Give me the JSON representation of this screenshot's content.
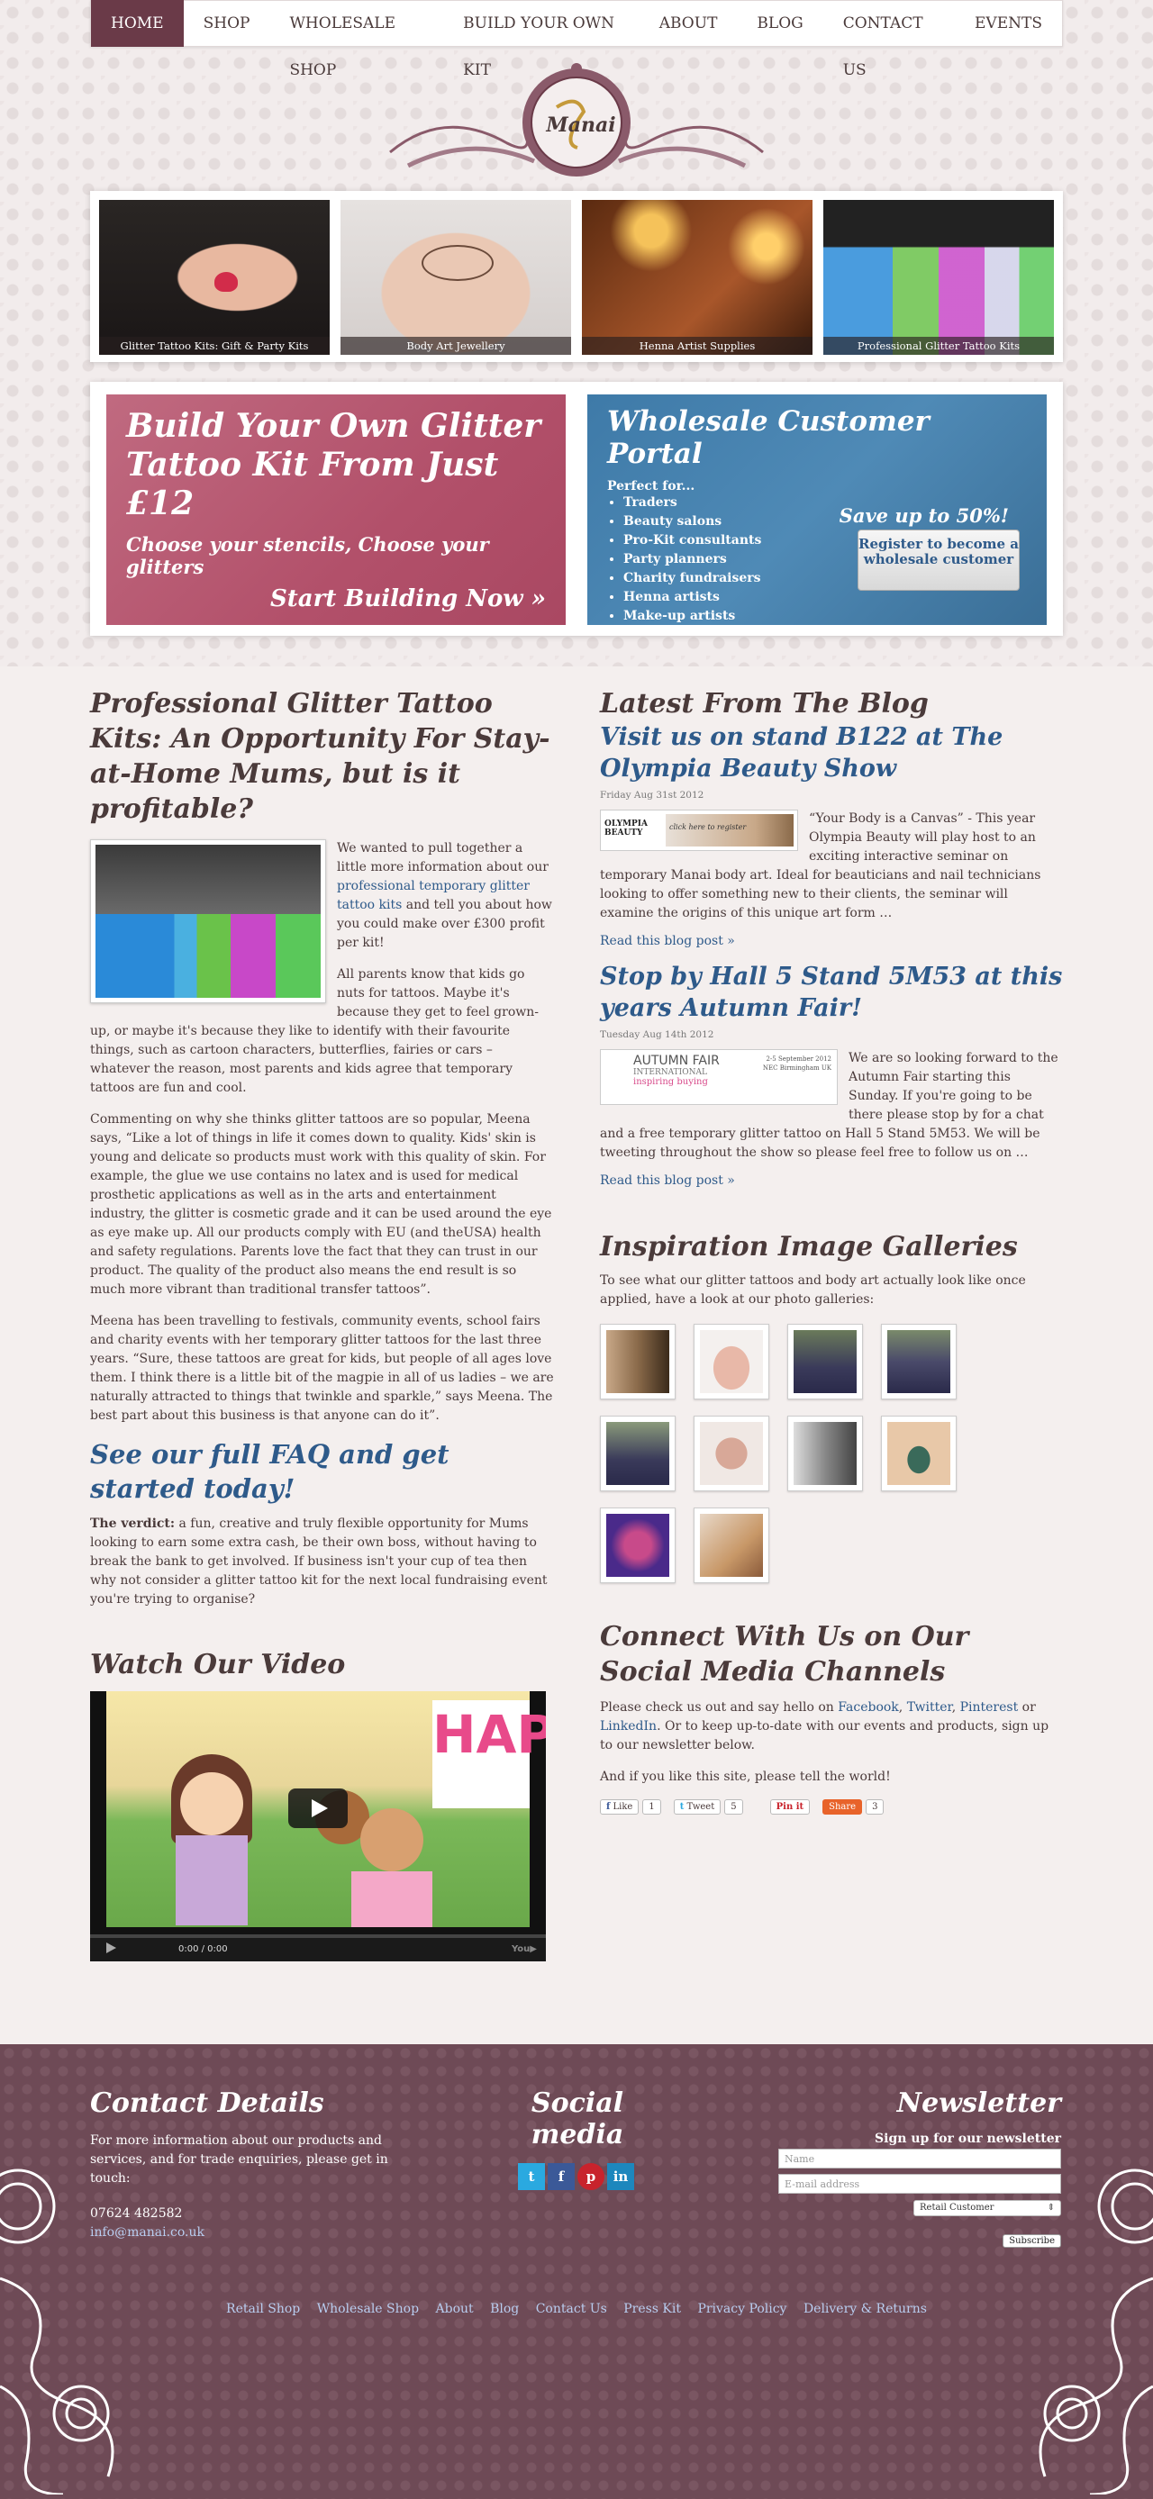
{
  "nav": {
    "items": [
      "HOME",
      "SHOP",
      "WHOLESALE SHOP",
      "BUILD YOUR OWN KIT",
      "ABOUT",
      "BLOG",
      "CONTACT US",
      "EVENTS"
    ]
  },
  "logo": {
    "text": "Manai"
  },
  "tiles": [
    {
      "caption": "Glitter Tattoo Kits: Gift & Party Kits"
    },
    {
      "caption": "Body Art Jewellery"
    },
    {
      "caption": "Henna Artist Supplies"
    },
    {
      "caption": "Professional Glitter Tattoo Kits"
    }
  ],
  "promo": {
    "kit_title": "Build Your Own Glitter Tattoo Kit From Just £12",
    "kit_sub": "Choose your stencils, Choose your glitters",
    "kit_cta": "Start Building Now »",
    "ws_title": "Wholesale Customer Portal",
    "ws_perfect": "Perfect for...",
    "ws_list": [
      "Traders",
      "Beauty salons",
      "Pro-Kit consultants",
      "Party planners",
      "Charity fundraisers",
      "Henna artists",
      "Make-up artists"
    ],
    "ws_save": "Save up to 50%!",
    "ws_button": "Register to become a wholesale customer"
  },
  "article": {
    "title": "Professional Glitter Tattoo Kits: An Opportunity For Stay-at-Home Mums, but is it profitable?",
    "p1a": "We wanted to pull together a little more information about our ",
    "p1link": "professional temporary glitter tattoo kits",
    "p1b": " and tell you about how you could make over £300 profit per kit!",
    "p2": "All parents know that kids go nuts for tattoos. Maybe it's because they get to feel grown-up, or maybe it's because they like to identify with their favourite things, such as cartoon characters, butterflies, fairies or cars – whatever the reason, most parents and kids agree that temporary tattoos are fun and cool.",
    "p3": "Commenting on why she thinks glitter tattoos are so popular, Meena says, “Like a lot of things in life it comes down to quality.  Kids' skin is young and delicate so products must work with this quality of skin.  For example, the glue we use contains no latex and is used for medical prosthetic applications as well as in the arts and entertainment industry, the glitter is cosmetic grade and it can be used around the eye as eye make up.  All our products comply with EU (and theUSA) health and safety regulations.  Parents love the fact that they can trust in our product.  The quality of the product also means the end result is so much more vibrant than traditional transfer tattoos”.",
    "p4": "Meena has been travelling to festivals, community events, school fairs and charity events with her temporary glitter tattoos for the last three years. “Sure, these tattoos are great for kids, but people of all ages love them. I think there is a little bit of the magpie in all of us ladies – we are naturally attracted to things that twinkle and sparkle,” says Meena. The best part about this business is that anyone can do it”.",
    "faq": "See our full FAQ and get started today!",
    "verdict_label": "The verdict:",
    "verdict": "  a fun, creative and truly flexible opportunity for Mums looking to earn some extra cash, be their own boss, without having to break the bank to get involved.  If business isn't your cup of tea then why not consider a glitter tattoo kit for the next local fundraising event you're trying to organise?"
  },
  "video": {
    "heading": "Watch Our Video",
    "time": "0:00 / 0:00",
    "banner": "HAPP"
  },
  "blog": {
    "heading": "Latest From The Blog",
    "posts": [
      {
        "title": "Visit us on stand B122 at The Olympia Beauty Show",
        "date": "Friday Aug 31st 2012",
        "img1": "OLYMPIA BEAUTY",
        "img2": "click here to register",
        "text": "“Your Body is a Canvas” - This year Olympia Beauty will play host to an exciting interactive seminar on temporary Manai body art. Ideal for beauticians and nail technicians looking to offer something new to their clients, the seminar will examine the origins of this unique art form …",
        "more": "Read this blog post »"
      },
      {
        "title": "Stop by Hall 5 Stand 5M53 at this years Autumn Fair!",
        "date": "Tuesday Aug 14th 2012",
        "img1": "AUTUMN FAIR",
        "img2": "INTERNATIONAL",
        "img3": "inspiring buying",
        "img4": "2-5 September 2012",
        "img5": "NEC Birmingham UK",
        "text": "We are so looking forward to the Autumn Fair starting this Sunday. If you're going to be there please stop by for a chat and a free temporary glitter tattoo on Hall 5 Stand 5M53. We will be tweeting throughout the show so please feel free to follow us on …",
        "more": "Read this blog post »"
      }
    ]
  },
  "galleries": {
    "heading": "Inspiration Image Galleries",
    "text": "To see what our glitter tattoos and body art actually look like once applied, have a look at our photo galleries:"
  },
  "social": {
    "heading": "Connect With Us on Our Social Media Channels",
    "t1": "Please check us out and say hello on ",
    "facebook": "Facebook",
    "twitter": "Twitter",
    "pinterest": "Pinterest",
    "linkedin": "LinkedIn",
    "t2": ". Or to keep up-to-date with our events and products, sign up to our newsletter below.",
    "t3": "And if you like this site, please tell the world!",
    "like": "Like",
    "like_count": "1",
    "tweet": "Tweet",
    "tweet_count": "5",
    "pin": "Pin it",
    "share": "Share",
    "share_count": "3"
  },
  "footer": {
    "contact_heading": "Contact Details",
    "contact_text": "For more information about our products and services, and for trade enquiries, please get in touch:",
    "phone": "07624 482582",
    "email": "info@manai.co.uk",
    "social_heading": "Social media",
    "newsletter_heading": "Newsletter",
    "signup": "Sign up for our newsletter",
    "name_ph": "Name",
    "email_ph": "E-mail address",
    "select": "Retail Customer",
    "subscribe": "Subscribe",
    "links": [
      "Retail Shop",
      "Wholesale Shop",
      "About",
      "Blog",
      "Contact Us",
      "Press Kit",
      "Privacy Policy",
      "Delivery & Returns"
    ]
  }
}
